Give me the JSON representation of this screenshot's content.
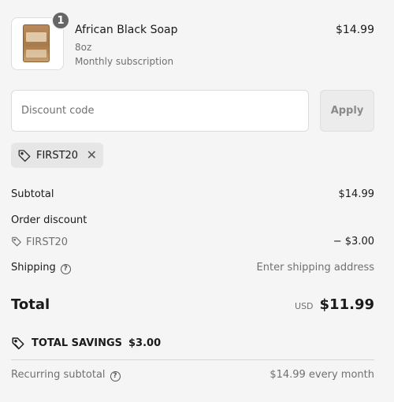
{
  "product": {
    "quantity": "1",
    "name": "African Black Soap",
    "variant": "8oz",
    "subscription": "Monthly subscription",
    "price": "$14.99"
  },
  "discount": {
    "placeholder": "Discount code",
    "apply_label": "Apply",
    "applied_code": "FIRST20"
  },
  "summary": {
    "subtotal_label": "Subtotal",
    "subtotal_value": "$14.99",
    "order_discount_label": "Order discount",
    "discount_code": "FIRST20",
    "discount_value": "− $3.00",
    "shipping_label": "Shipping",
    "shipping_value": "Enter shipping address",
    "total_label": "Total",
    "currency": "USD",
    "total_value": "$11.99",
    "savings_label": "TOTAL SAVINGS",
    "savings_value": "$3.00",
    "recurring_label": "Recurring subtotal",
    "recurring_value": "$14.99 every month"
  }
}
